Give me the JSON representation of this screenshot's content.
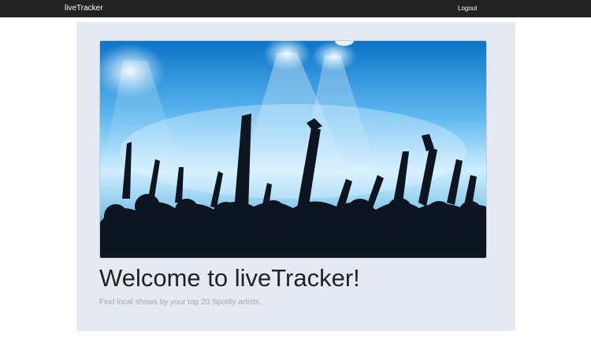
{
  "navbar": {
    "brand": "liveTracker",
    "logout_label": "Logout"
  },
  "hero": {
    "image": "concert-crowd-image"
  },
  "main": {
    "title": "Welcome to liveTracker!",
    "subtitle": "Find local shows by your top 20 Spotify artists."
  },
  "colors": {
    "navbar_bg": "#222222",
    "jumbotron_bg": "#e5e9f1",
    "stage_light": "#8fd0ff"
  }
}
